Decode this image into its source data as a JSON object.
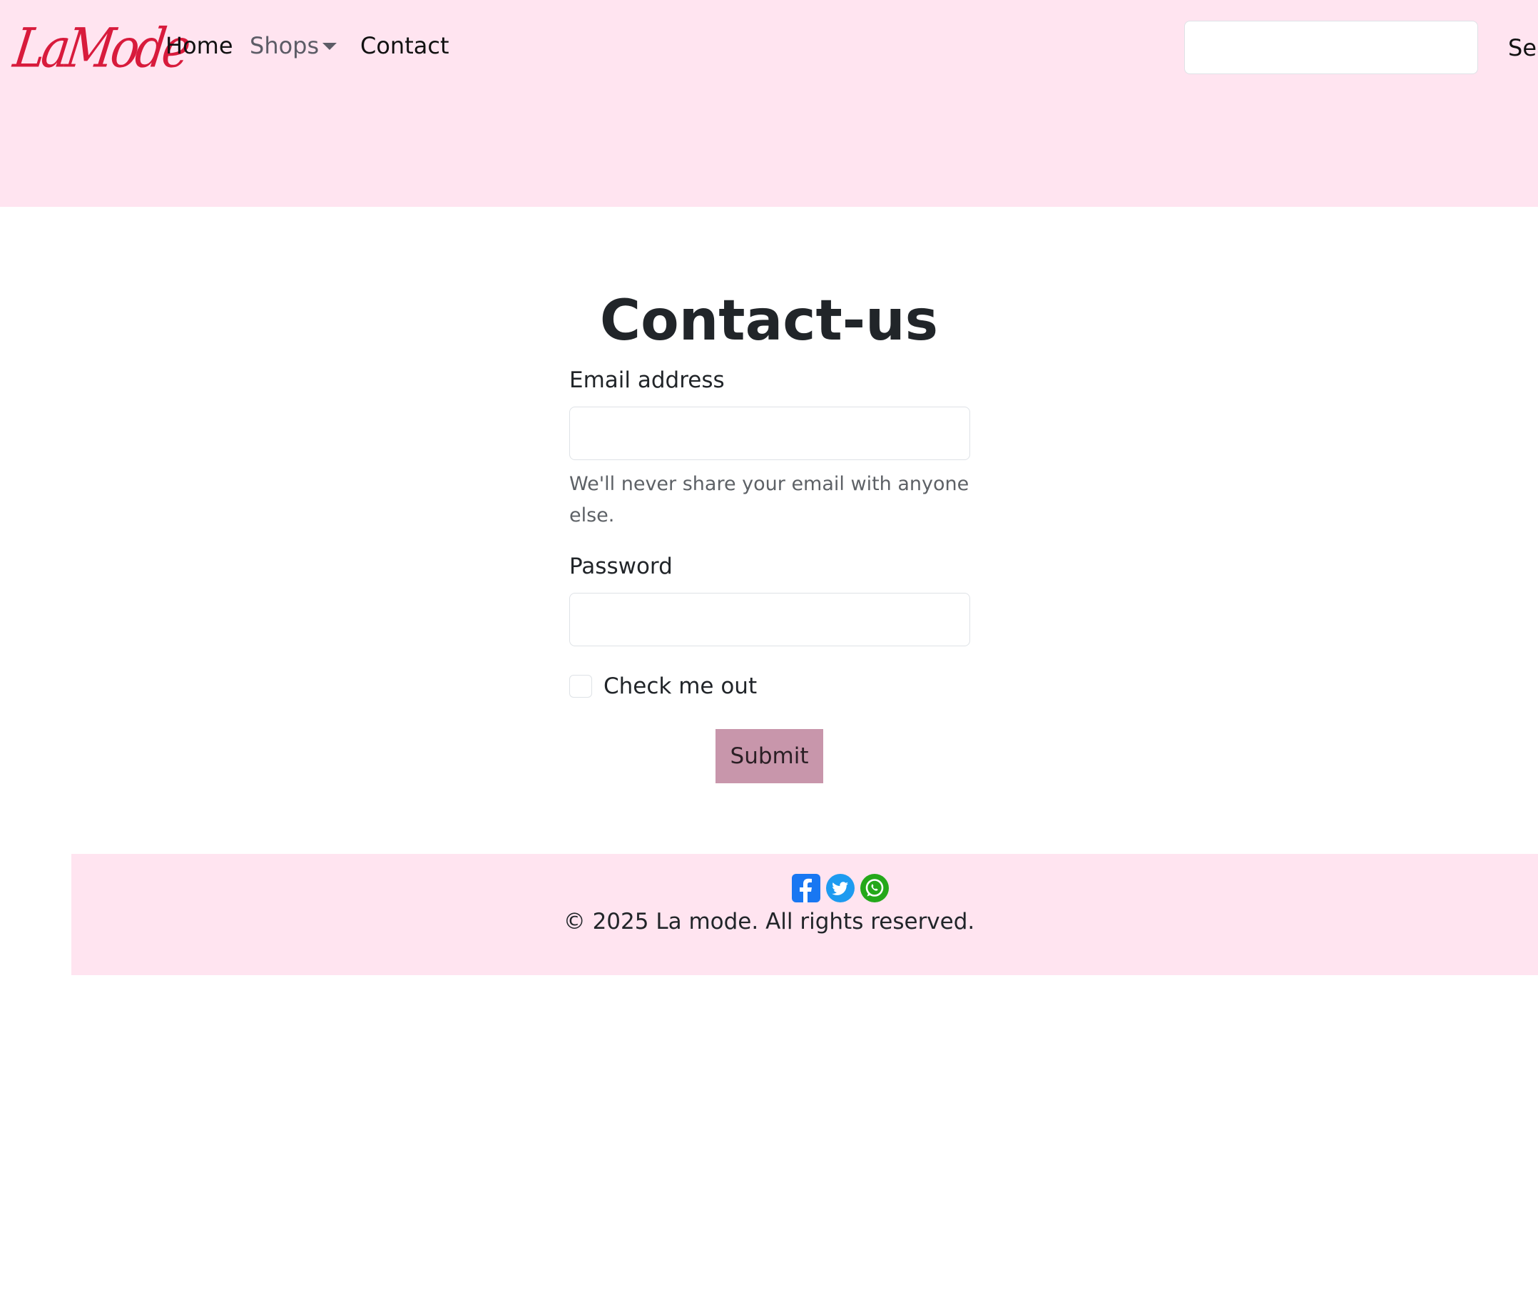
{
  "header": {
    "brand": "LaMode",
    "nav": {
      "home": "Home",
      "shops": "Shops",
      "contact": "Contact"
    },
    "search": {
      "placeholder": "",
      "button_label": "Search"
    }
  },
  "main": {
    "title": "Contact-us",
    "email": {
      "label": "Email address",
      "placeholder": "",
      "help": "We'll never share your email with anyone else."
    },
    "password": {
      "label": "Password",
      "placeholder": ""
    },
    "checkbox": {
      "label": "Check me out",
      "checked": false
    },
    "submit_label": "Submit"
  },
  "footer": {
    "social_icons": [
      "facebook-icon",
      "twitter-icon",
      "whatsapp-icon"
    ],
    "copyright": "© 2025 La mode. All rights reserved."
  },
  "colors": {
    "header_bg": "#ffe4f0",
    "brand": "#d81b3c",
    "submit_bg": "#c896ab",
    "facebook": "#1877f2",
    "twitter": "#1d9bf0",
    "whatsapp": "#25a81a"
  }
}
